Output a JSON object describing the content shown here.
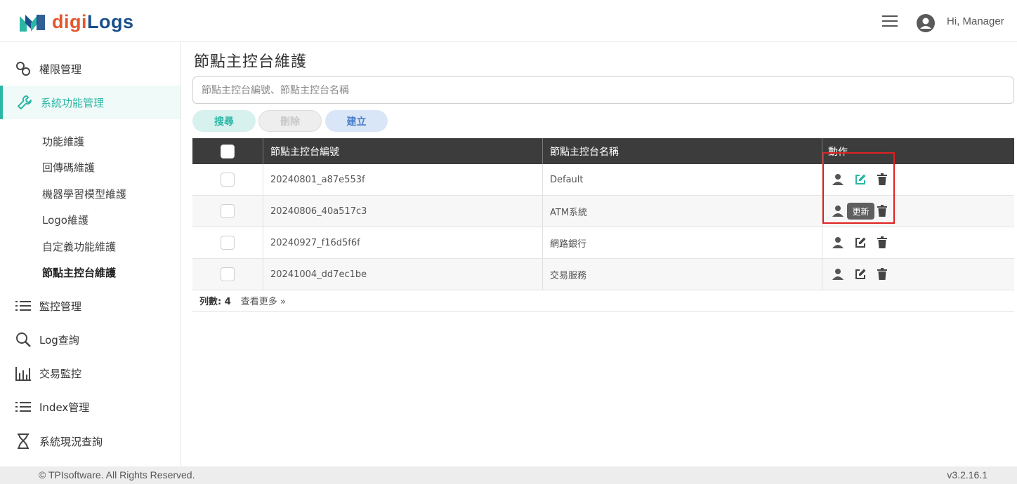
{
  "header": {
    "logo_part1": "digi",
    "logo_part2": "Logs",
    "greeting": "Hi, Manager"
  },
  "sidebar": {
    "items": [
      {
        "label": "權限管理",
        "icon": "users-icon"
      },
      {
        "label": "系統功能管理",
        "icon": "wrench-icon",
        "active": true
      },
      {
        "label": "監控管理",
        "icon": "list-icon"
      },
      {
        "label": "Log查詢",
        "icon": "search-icon"
      },
      {
        "label": "交易監控",
        "icon": "bar-chart-icon"
      },
      {
        "label": "Index管理",
        "icon": "list-icon"
      },
      {
        "label": "系統現況查詢",
        "icon": "hourglass-icon"
      }
    ],
    "sub_items": [
      "功能維護",
      "回傳碼維護",
      "機器學習模型維護",
      "Logo維護",
      "自定義功能維護",
      "節點主控台維護"
    ]
  },
  "main": {
    "title": "節點主控台維護",
    "search_placeholder": "節點主控台編號、節點主控台名稱",
    "buttons": {
      "search": "搜尋",
      "delete": "刪除",
      "create": "建立"
    },
    "columns": [
      "節點主控台編號",
      "節點主控台名稱",
      "動作"
    ],
    "rows": [
      {
        "id": "20240801_a87e553f",
        "name": "Default"
      },
      {
        "id": "20240806_40a517c3",
        "name": "ATM系統"
      },
      {
        "id": "20240927_f16d5f6f",
        "name": "網路銀行"
      },
      {
        "id": "20241004_dd7ec1be",
        "name": "交易服務"
      }
    ],
    "row_count_label": "列數: 4",
    "see_more": "查看更多",
    "tooltip": "更新"
  },
  "colors": {
    "accent": "#2bb7a5",
    "header_bg": "#3c3c3c",
    "highlight": "#e02020"
  },
  "footer": {
    "copyright": "© TPIsoftware. All Rights Reserved.",
    "version": "v3.2.16.1"
  }
}
